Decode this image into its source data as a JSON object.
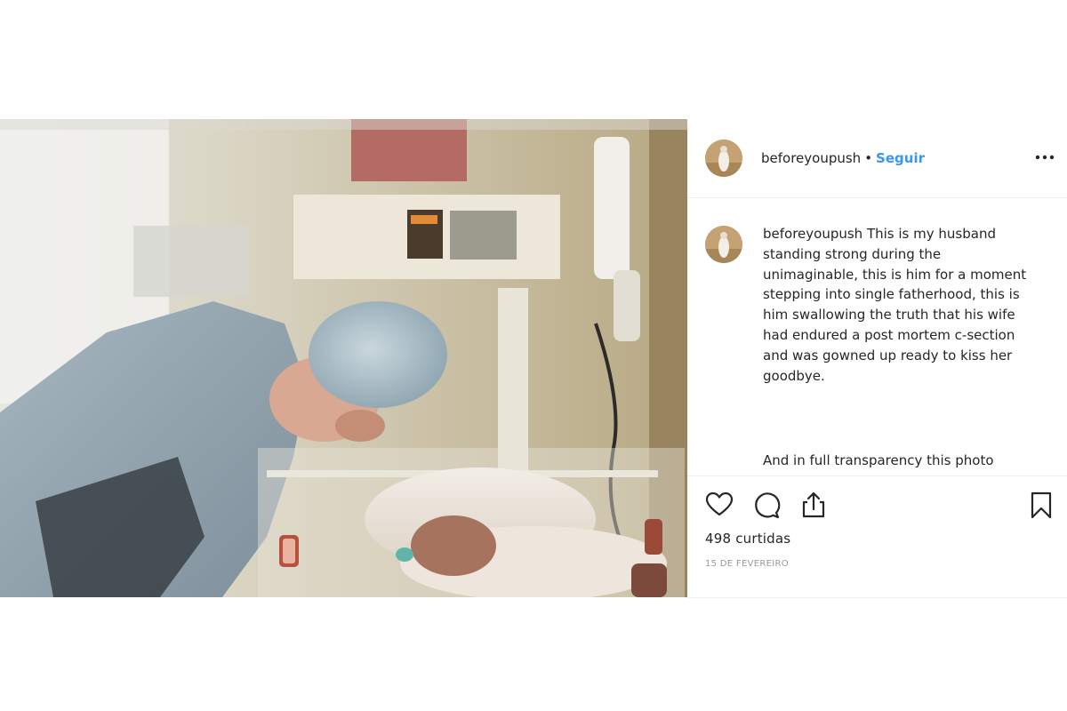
{
  "post": {
    "username": "beforeyoupush",
    "separator": "•",
    "follow_label": "Seguir",
    "more_icon": "more-horizontal-icon",
    "caption": {
      "username": "beforeyoupush",
      "text": "This is my husband standing strong during the unimaginable, this is him for a moment stepping into single fatherhood, this is him swallowing the truth that his wife had endured a post mortem c-section and was gowned up ready to kiss her goodbye.",
      "continuation": "And in full transparency this photo"
    },
    "actions": {
      "like_icon": "heart-icon",
      "comment_icon": "comment-icon",
      "share_icon": "share-icon",
      "save_icon": "bookmark-icon"
    },
    "likes": "498 curtidas",
    "date": "15 DE FEVEREIRO"
  },
  "colors": {
    "link_blue": "#3897f0",
    "text_primary": "#262626",
    "text_muted": "#999999",
    "divider": "#efefef"
  }
}
